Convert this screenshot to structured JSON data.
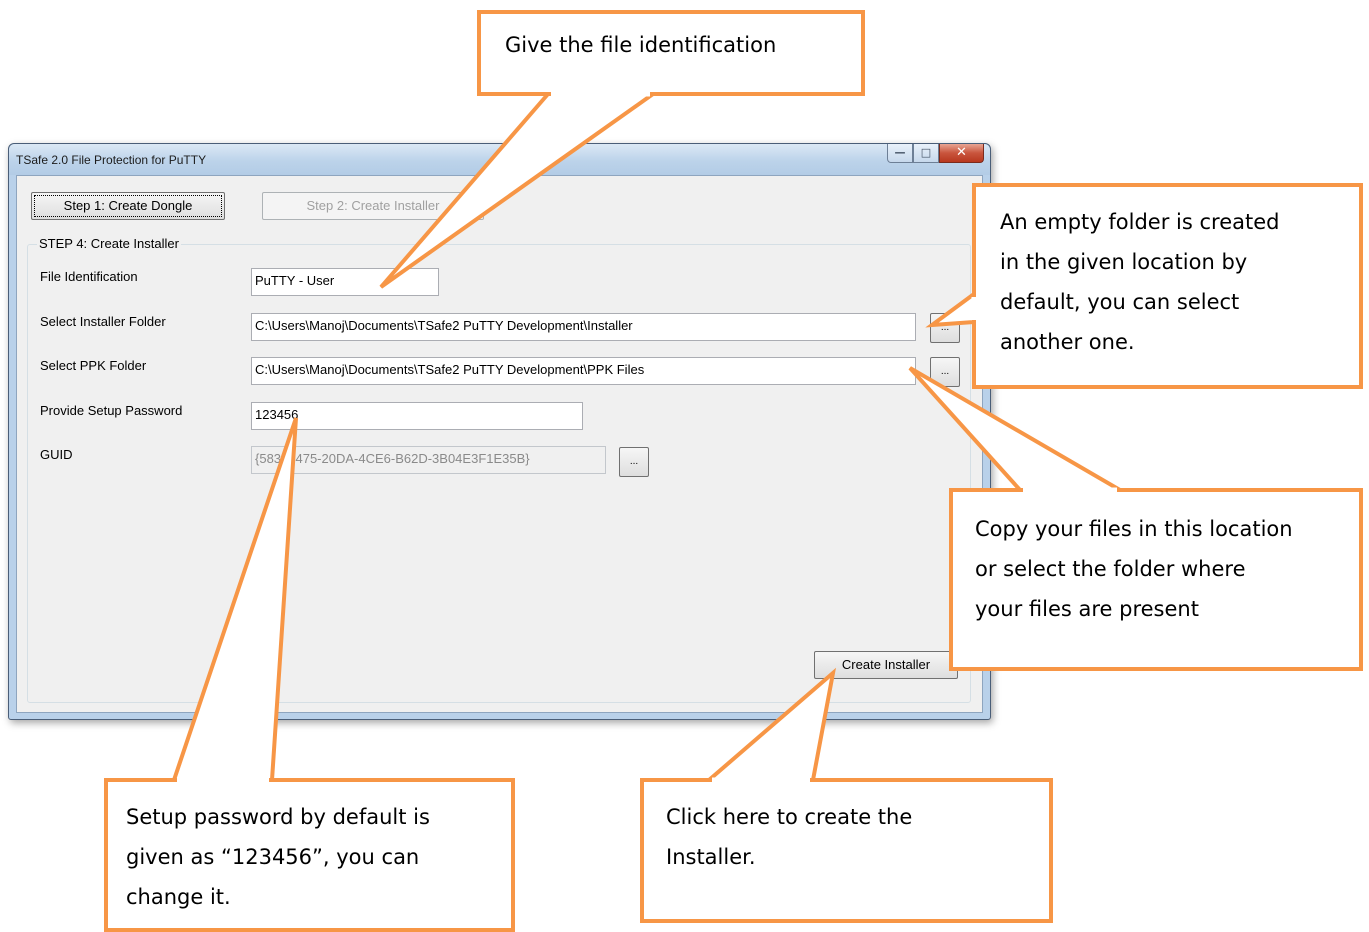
{
  "window": {
    "title": "TSafe 2.0 File Protection for PuTTY",
    "controls": [
      "minimize",
      "maximize",
      "close"
    ]
  },
  "steps": {
    "step1_label": "Step 1: Create Dongle",
    "step2_label": "Step 2: Create Installer"
  },
  "group": {
    "legend": "STEP 4: Create Installer",
    "file_id": {
      "label": "File Identification",
      "value": "PuTTY - User"
    },
    "installer_folder": {
      "label": "Select Installer Folder",
      "value": "C:\\Users\\Manoj\\Documents\\TSafe2 PuTTY Development\\Installer"
    },
    "ppk_folder": {
      "label": "Select PPK Folder",
      "value": "C:\\Users\\Manoj\\Documents\\TSafe2 PuTTY Development\\PPK Files"
    },
    "setup_password": {
      "label": "Provide Setup Password",
      "value": "123456"
    },
    "guid": {
      "label": "GUID",
      "value": "{58391475-20DA-4CE6-B62D-3B04E3F1E35B}"
    },
    "browse_label": "...",
    "create_installer_label": "Create Installer"
  },
  "callouts": {
    "file_id": [
      "Give the file identification"
    ],
    "installer_folder": [
      "An empty folder is created",
      "in the given location by",
      "default, you can select",
      "another  one."
    ],
    "ppk_folder": [
      "Copy your files in this location",
      "or  select the folder where",
      "your files are present"
    ],
    "password": [
      "Setup password by default is",
      "given as “123456”, you can",
      "change it."
    ],
    "create": [
      "Click here to create the",
      "Installer."
    ]
  },
  "colors": {
    "callout_border": "#f79646",
    "window_frame": "#b9d1ea",
    "dialog_bg": "#f0f0f0"
  }
}
